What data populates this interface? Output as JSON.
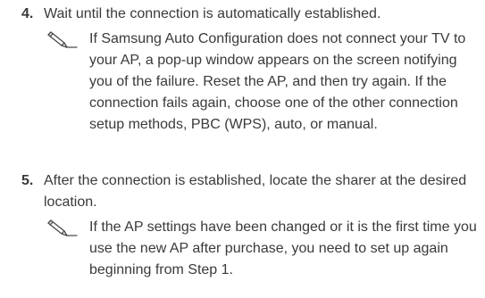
{
  "steps": [
    {
      "number": "4.",
      "text": "Wait until the connection is automatically established.",
      "note": {
        "icon": "note-pencil-icon",
        "text": "If Samsung Auto Configuration does not connect your TV to your AP, a pop-up window appears on the screen notifying you of the failure. Reset the AP, and then try again. If the connection fails again, choose one of the other connection setup methods, PBC (WPS), auto, or manual."
      }
    },
    {
      "number": "5.",
      "text": "After the connection is established, locate the sharer at the desired location.",
      "note": {
        "icon": "note-pencil-icon",
        "text": "If the AP settings have been changed or it is the first time you use the new AP after purchase, you need to set up again beginning from Step 1."
      }
    }
  ]
}
